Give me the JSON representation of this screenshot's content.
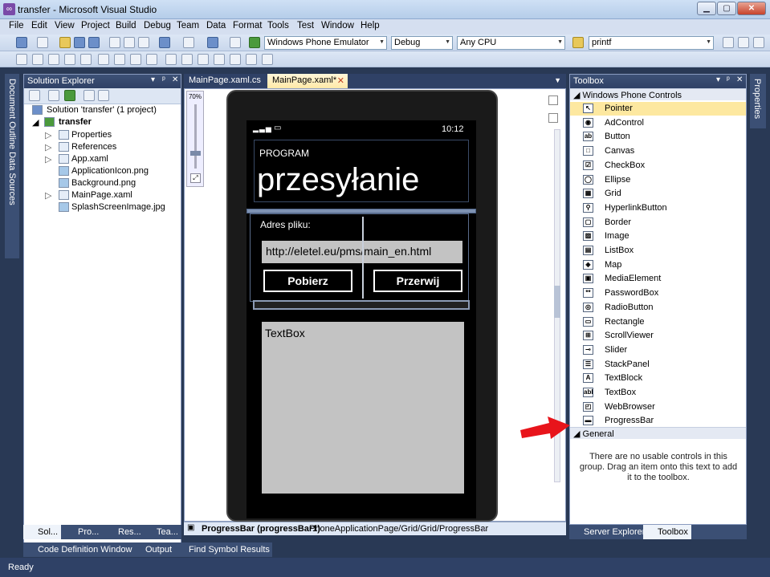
{
  "window": {
    "title": "transfer - Microsoft Visual Studio",
    "app_icon": "vs-icon"
  },
  "menu": [
    "File",
    "Edit",
    "View",
    "Project",
    "Build",
    "Debug",
    "Team",
    "Data",
    "Format",
    "Tools",
    "Test",
    "Window",
    "Help"
  ],
  "toolbar": {
    "target": "Windows Phone Emulator",
    "config": "Debug",
    "platform": "Any CPU",
    "find": "printf"
  },
  "solution_explorer": {
    "title": "Solution Explorer",
    "solution": "Solution 'transfer' (1 project)",
    "project": "transfer",
    "items": [
      "Properties",
      "References",
      "App.xaml",
      "ApplicationIcon.png",
      "Background.png",
      "MainPage.xaml",
      "SplashScreenImage.jpg"
    ],
    "bottom_tabs": [
      "Sol...",
      "Pro...",
      "Res...",
      "Tea..."
    ]
  },
  "left_strip": {
    "label": "Document Outline  Data Sources"
  },
  "doc_tabs": [
    "MainPage.xaml.cs",
    "MainPage.xaml*"
  ],
  "designer": {
    "zoom": "70%",
    "status_time": "10:12",
    "app_title": "PROGRAM",
    "page_title": "przesyłanie",
    "file_label": "Adres pliku:",
    "url_value": "http://eletel.eu/pms/main_en.html",
    "btn_download": "Pobierz",
    "btn_rewind": "Przerwij",
    "textbox": "TextBox",
    "breadcrumb_bold": "ProgressBar (progressBar1)",
    "breadcrumb_path": "PhoneApplicationPage/Grid/Grid/ProgressBar"
  },
  "toolbox": {
    "title": "Toolbox",
    "group1": "Windows Phone Controls",
    "items": [
      "Pointer",
      "AdControl",
      "Button",
      "Canvas",
      "CheckBox",
      "Ellipse",
      "Grid",
      "HyperlinkButton",
      "Border",
      "Image",
      "ListBox",
      "Map",
      "MediaElement",
      "PasswordBox",
      "RadioButton",
      "Rectangle",
      "ScrollViewer",
      "Slider",
      "StackPanel",
      "TextBlock",
      "TextBox",
      "WebBrowser",
      "ProgressBar"
    ],
    "group2": "General",
    "empty_msg": "There are no usable controls in this group. Drag an item onto this text to add it to the toolbox.",
    "bottom_tabs": [
      "Server Explorer",
      "Toolbox"
    ]
  },
  "right_strip": {
    "label": "Properties"
  },
  "output_tabs": [
    "Code Definition Window",
    "Output",
    "Find Symbol Results"
  ],
  "status": "Ready",
  "colors": {
    "accent_arrow": "#e8141b",
    "panel_header": "#2f4166"
  }
}
